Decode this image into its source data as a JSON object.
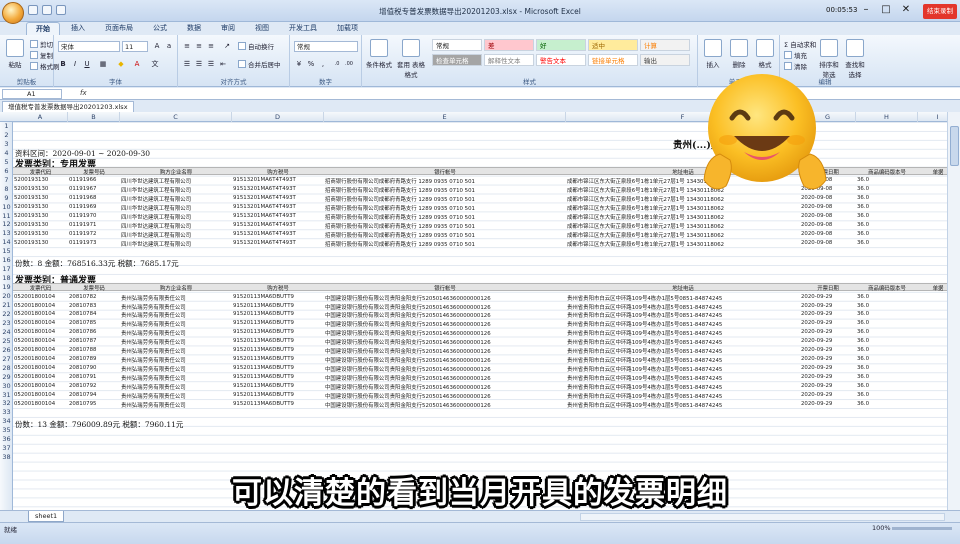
{
  "window": {
    "title": "增值税专普发票数据导出20201203.xlsx - Microsoft Excel",
    "record_time": "00:05:53",
    "record_stop_label": "结束录制",
    "min_icon": "minimize-icon",
    "max_icon": "maximize-icon",
    "close_icon": "close-icon"
  },
  "ribbon": {
    "tabs": [
      "开始",
      "插入",
      "页面布局",
      "公式",
      "数据",
      "审阅",
      "视图",
      "开发工具",
      "加载项"
    ],
    "paste": "粘贴",
    "cut": "剪切",
    "copy": "复制",
    "format_painter": "格式刷",
    "clipboard_group": "剪贴板",
    "font_name": "宋体",
    "font_size": "11",
    "font_group": "字体",
    "wrap_text": "自动换行",
    "merge_center": "合并后居中",
    "align_group": "对齐方式",
    "number_format": "常规",
    "number_group": "数字",
    "cond_format": "条件格式",
    "table_format": "套用\n表格格式",
    "styles": [
      {
        "label": "常规",
        "bg": "#ffffff",
        "fg": "#111111"
      },
      {
        "label": "差",
        "bg": "#ffc7ce",
        "fg": "#9c0006"
      },
      {
        "label": "好",
        "bg": "#c6efce",
        "fg": "#006100"
      },
      {
        "label": "适中",
        "bg": "#ffeb9c",
        "fg": "#9c6500"
      },
      {
        "label": "计算",
        "bg": "#f2f2f2",
        "fg": "#fa7d00"
      },
      {
        "label": "检查单元格",
        "bg": "#a5a5a5",
        "fg": "#ffffff"
      },
      {
        "label": "解释性文本",
        "bg": "#ffffff",
        "fg": "#7f7f7f"
      },
      {
        "label": "警告文本",
        "bg": "#ffffff",
        "fg": "#ff0000"
      },
      {
        "label": "链接单元格",
        "bg": "#ffffff",
        "fg": "#fa7d00"
      },
      {
        "label": "输出",
        "bg": "#f2f2f2",
        "fg": "#3f3f3f"
      }
    ],
    "style_group": "样式",
    "insert": "插入",
    "delete": "删除",
    "format": "格式",
    "cells_group": "单元格",
    "autosum": "自动求和",
    "fill": "填充",
    "clear": "清除",
    "sort_filter": "排序和\n筛选",
    "find_select": "查找和\n选择",
    "edit_group": "编辑"
  },
  "formula_bar": {
    "cell_ref": "A1",
    "fx": "fx",
    "content": ""
  },
  "workbook_tab": "增值税专普发票数据导出20201203.xlsx",
  "columns": [
    "A",
    "B",
    "C",
    "D",
    "E",
    "F",
    "G",
    "H",
    "I"
  ],
  "rows": [
    "1",
    "2",
    "3",
    "4",
    "5",
    "6",
    "7",
    "8",
    "9",
    "10",
    "11",
    "12",
    "13",
    "14",
    "15",
    "16",
    "17",
    "18",
    "19",
    "20",
    "21",
    "22",
    "23",
    "24",
    "25",
    "26",
    "27",
    "28",
    "29",
    "30",
    "31",
    "32",
    "33",
    "34",
    "35",
    "36",
    "37",
    "38"
  ],
  "sheet": {
    "big_title": "贵州(...)票数据",
    "period": "资料区间：2020-09-01 ~ 2020-09-30",
    "section1_title": "发票类别：专用发票",
    "section2_title": "发票类别：普通发票",
    "headers": [
      "发票代码",
      "发票号码",
      "购方企业名称",
      "购方税号",
      "银行帐号",
      "地址电话",
      "开票日期",
      "商品编码版本号",
      "单据"
    ],
    "special_rows": [
      [
        "5200193130",
        "01191966",
        "四川华世达建筑工程有限公司",
        "91513201MA6T4T493T",
        "招商银行股份有限公司成都府青路支行 1289 0935 0710 501",
        "成都市锦江区东大街芷泉段6号1栋1单元27层1号 13430118062",
        "2020-09-08",
        "36.0"
      ],
      [
        "5200193130",
        "01191967",
        "四川华世达建筑工程有限公司",
        "91513201MA6T4T493T",
        "招商银行股份有限公司成都府青路支行 1289 0935 0710 501",
        "成都市锦江区东大街芷泉段6号1栋1单元27层1号 13430118062",
        "2020-09-08",
        "36.0"
      ],
      [
        "5200193130",
        "01191968",
        "四川华世达建筑工程有限公司",
        "91513201MA6T4T493T",
        "招商银行股份有限公司成都府青路支行 1289 0935 0710 501",
        "成都市锦江区东大街芷泉段6号1栋1单元27层1号 13430118062",
        "2020-09-08",
        "36.0"
      ],
      [
        "5200193130",
        "01191969",
        "四川华世达建筑工程有限公司",
        "91513201MA6T4T493T",
        "招商银行股份有限公司成都府青路支行 1289 0935 0710 501",
        "成都市锦江区东大街芷泉段6号1栋1单元27层1号 13430118062",
        "2020-09-08",
        "36.0"
      ],
      [
        "5200193130",
        "01191970",
        "四川华世达建筑工程有限公司",
        "91513201MA6T4T493T",
        "招商银行股份有限公司成都府青路支行 1289 0935 0710 501",
        "成都市锦江区东大街芷泉段6号1栋1单元27层1号 13430118062",
        "2020-09-08",
        "36.0"
      ],
      [
        "5200193130",
        "01191971",
        "四川华世达建筑工程有限公司",
        "91513201MA6T4T493T",
        "招商银行股份有限公司成都府青路支行 1289 0935 0710 501",
        "成都市锦江区东大街芷泉段6号1栋1单元27层1号 13430118062",
        "2020-09-08",
        "36.0"
      ],
      [
        "5200193130",
        "01191972",
        "四川华世达建筑工程有限公司",
        "91513201MA6T4T493T",
        "招商银行股份有限公司成都府青路支行 1289 0935 0710 501",
        "成都市锦江区东大街芷泉段6号1栋1单元27层1号 13430118062",
        "2020-09-08",
        "36.0"
      ],
      [
        "5200193130",
        "01191973",
        "四川华世达建筑工程有限公司",
        "91513201MA6T4T493T",
        "招商银行股份有限公司成都府青路支行 1289 0935 0710 501",
        "成都市锦江区东大街芷泉段6号1栋1单元27层1号 13430118062",
        "2020-09-08",
        "36.0"
      ]
    ],
    "special_summary": "份数：8  金额：768516.33元  税额：7685.17元",
    "general_rows": [
      [
        "052001800104",
        "20810782",
        "贵州弘瑞劳务有限责任公司",
        "91520113MA6DBUTT9",
        "中国建设银行股份有限公司贵阳金阳支行52050146360000000126",
        "贵州省贵阳市白云区中环路109号4栋办1层5号0851-84874245",
        "2020-09-29",
        "36.0"
      ],
      [
        "052001800104",
        "20810783",
        "贵州弘瑞劳务有限责任公司",
        "91520113MA6DBUTT9",
        "中国建设银行股份有限公司贵阳金阳支行52050146360000000126",
        "贵州省贵阳市白云区中环路109号4栋办1层5号0851-84874245",
        "2020-09-29",
        "36.0"
      ],
      [
        "052001800104",
        "20810784",
        "贵州弘瑞劳务有限责任公司",
        "91520113MA6DBUTT9",
        "中国建设银行股份有限公司贵阳金阳支行52050146360000000126",
        "贵州省贵阳市白云区中环路109号4栋办1层5号0851-84874245",
        "2020-09-29",
        "36.0"
      ],
      [
        "052001800104",
        "20810785",
        "贵州弘瑞劳务有限责任公司",
        "91520113MA6DBUTT9",
        "中国建设银行股份有限公司贵阳金阳支行52050146360000000126",
        "贵州省贵阳市白云区中环路109号4栋办1层5号0851-84874245",
        "2020-09-29",
        "36.0"
      ],
      [
        "052001800104",
        "20810786",
        "贵州弘瑞劳务有限责任公司",
        "91520113MA6DBUTT9",
        "中国建设银行股份有限公司贵阳金阳支行52050146360000000126",
        "贵州省贵阳市白云区中环路109号4栋办1层5号0851-84874245",
        "2020-09-29",
        "36.0"
      ],
      [
        "052001800104",
        "20810787",
        "贵州弘瑞劳务有限责任公司",
        "91520113MA6DBUTT9",
        "中国建设银行股份有限公司贵阳金阳支行52050146360000000126",
        "贵州省贵阳市白云区中环路109号4栋办1层5号0851-84874245",
        "2020-09-29",
        "36.0"
      ],
      [
        "052001800104",
        "20810788",
        "贵州弘瑞劳务有限责任公司",
        "91520113MA6DBUTT9",
        "中国建设银行股份有限公司贵阳金阳支行52050146360000000126",
        "贵州省贵阳市白云区中环路109号4栋办1层5号0851-84874245",
        "2020-09-29",
        "36.0"
      ],
      [
        "052001800104",
        "20810789",
        "贵州弘瑞劳务有限责任公司",
        "91520113MA6DBUTT9",
        "中国建设银行股份有限公司贵阳金阳支行52050146360000000126",
        "贵州省贵阳市白云区中环路109号4栋办1层5号0851-84874245",
        "2020-09-29",
        "36.0"
      ],
      [
        "052001800104",
        "20810790",
        "贵州弘瑞劳务有限责任公司",
        "91520113MA6DBUTT9",
        "中国建设银行股份有限公司贵阳金阳支行52050146360000000126",
        "贵州省贵阳市白云区中环路109号4栋办1层5号0851-84874245",
        "2020-09-29",
        "36.0"
      ],
      [
        "052001800104",
        "20810791",
        "贵州弘瑞劳务有限责任公司",
        "91520113MA6DBUTT9",
        "中国建设银行股份有限公司贵阳金阳支行52050146360000000126",
        "贵州省贵阳市白云区中环路109号4栋办1层5号0851-84874245",
        "2020-09-29",
        "36.0"
      ],
      [
        "052001800104",
        "20810792",
        "贵州弘瑞劳务有限责任公司",
        "91520113MA6DBUTT9",
        "中国建设银行股份有限公司贵阳金阳支行52050146360000000126",
        "贵州省贵阳市白云区中环路109号4栋办1层5号0851-84874245",
        "2020-09-29",
        "36.0"
      ],
      [
        "052001800104",
        "20810794",
        "贵州弘瑞劳务有限责任公司",
        "91520113MA6DBUTT9",
        "中国建设银行股份有限公司贵阳金阳支行52050146360000000126",
        "贵州省贵阳市白云区中环路109号4栋办1层5号0851-84874245",
        "2020-09-29",
        "36.0"
      ],
      [
        "052001800104",
        "20810795",
        "贵州弘瑞劳务有限责任公司",
        "91520113MA6DBUTT9",
        "中国建设银行股份有限公司贵阳金阳支行52050146360000000126",
        "贵州省贵阳市白云区中环路109号4栋办1层5号0851-84874245",
        "2020-09-29",
        "36.0"
      ]
    ],
    "general_summary": "份数：13  金额：796009.89元  税额：7960.11元"
  },
  "sheet_tab": "sheet1",
  "status": {
    "ready": "就绪",
    "zoom": "100%"
  },
  "caption": "可以清楚的看到当月开具的发票明细"
}
